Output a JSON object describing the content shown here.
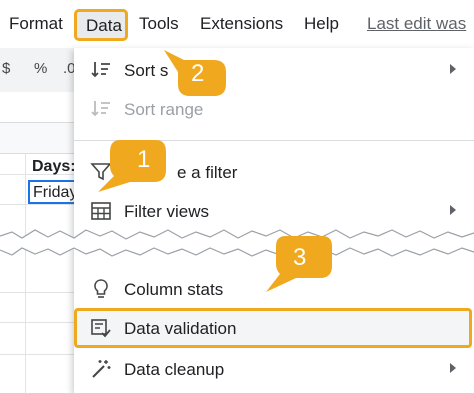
{
  "menubar": {
    "items": [
      "Format",
      "Data",
      "Tools",
      "Extensions",
      "Help"
    ],
    "last_edit": "Last edit was"
  },
  "toolbar": {
    "glyphs": [
      "$",
      "%",
      ".0"
    ]
  },
  "sheet": {
    "cells": {
      "days_header": "Days:",
      "selected_value": "Friday"
    }
  },
  "dropdown": {
    "items": [
      {
        "label": "Sort sheet",
        "visible_label": "Sort s",
        "icon": "sort-icon",
        "submenu": true,
        "disabled": false
      },
      {
        "label": "Sort range",
        "icon": "sort-range-icon",
        "submenu": false,
        "disabled": true
      },
      {
        "label": "Create a filter",
        "visible_label": "e a filter",
        "icon": "filter-icon",
        "submenu": false,
        "disabled": false
      },
      {
        "label": "Filter views",
        "icon": "filter-views-icon",
        "submenu": true,
        "disabled": false
      },
      {
        "label": "Column stats",
        "icon": "lightbulb-icon",
        "submenu": false,
        "disabled": false
      },
      {
        "label": "Data validation",
        "icon": "data-validation-icon",
        "submenu": false,
        "disabled": false
      },
      {
        "label": "Data cleanup",
        "icon": "magic-wand-icon",
        "submenu": true,
        "disabled": false
      }
    ]
  },
  "callouts": [
    {
      "number": "1",
      "color": "#f0a81e"
    },
    {
      "number": "2",
      "color": "#f0a81e"
    },
    {
      "number": "3",
      "color": "#f0a81e"
    }
  ],
  "colors": {
    "accent": "#f0a81e",
    "selection": "#1a73e8"
  }
}
